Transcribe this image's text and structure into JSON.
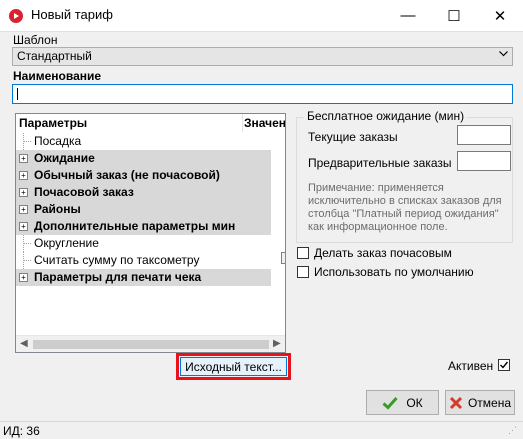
{
  "window": {
    "title": "Новый тариф",
    "min_glyph": "—",
    "max_glyph": "☐",
    "close_glyph": "✕"
  },
  "template": {
    "label": "Шаблон",
    "value": "Стандартный"
  },
  "name": {
    "label": "Наименование",
    "value": ""
  },
  "params_tree": {
    "col_params": "Параметры",
    "col_value": "Значен",
    "rows": [
      {
        "label": "Посадка",
        "category": false
      },
      {
        "label": "Ожидание",
        "category": true
      },
      {
        "label": "Обычный заказ (не почасовой)",
        "category": true
      },
      {
        "label": "Почасовой заказ",
        "category": true
      },
      {
        "label": "Районы",
        "category": true
      },
      {
        "label": "Дополнительные параметры мин",
        "category": true
      },
      {
        "label": "Округление",
        "category": false
      },
      {
        "label": "Считать сумму по таксометру",
        "category": false
      },
      {
        "label": "Параметры для печати чека",
        "category": true
      }
    ]
  },
  "free_wait": {
    "title": "Бесплатное ожидание (мин)",
    "current_label": "Текущие заказы",
    "current_value": "",
    "preliminary_label": "Предварительные заказы",
    "preliminary_value": "",
    "note": "Примечание: применяется исключительно в списках заказов для столбца \"Платный период ожидания\" как информационное поле."
  },
  "checks": {
    "hourly_label": "Делать заказ почасовым",
    "default_label": "Использовать по умолчанию",
    "active_label": "Активен"
  },
  "buttons": {
    "source": "Исходный текст...",
    "ok": "ОК",
    "cancel": "Отмена"
  },
  "status": {
    "id": "ИД: 36"
  },
  "colors": {
    "accent": "#0078d7",
    "highlight": "#e8121b",
    "ok_green": "#3a9a25",
    "cancel_red": "#d33a2c"
  }
}
